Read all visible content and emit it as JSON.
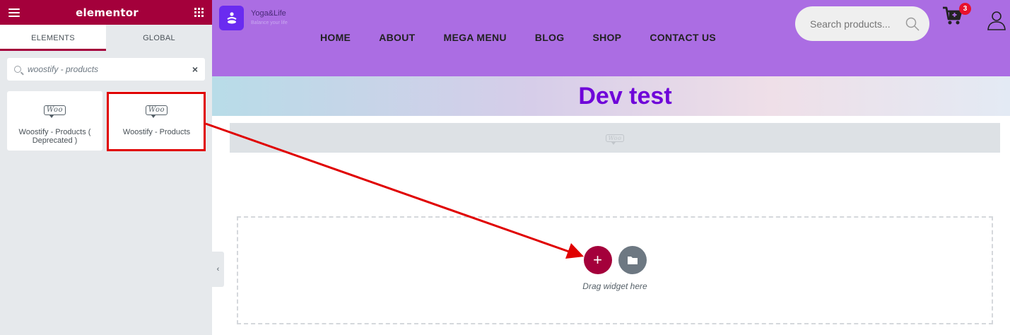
{
  "panel": {
    "brand": "elementor",
    "tabs": [
      {
        "label": "ELEMENTS",
        "active": true
      },
      {
        "label": "GLOBAL",
        "active": false
      }
    ],
    "search": {
      "value": "woostify - products",
      "clear": "×"
    },
    "widgets": [
      {
        "icon": "woo-icon",
        "icon_text": "Woo",
        "title": "Woostify - Products ( Deprecated )"
      },
      {
        "icon": "woo-icon",
        "icon_text": "Woo",
        "title": "Woostify - Products",
        "highlighted": true
      }
    ],
    "collapse_glyph": "‹",
    "accent_color": "#a4003b"
  },
  "site": {
    "logo": {
      "name": "Yoga&Life",
      "tagline": "Balance your life"
    },
    "nav": [
      "HOME",
      "ABOUT",
      "MEGA MENU",
      "BLOG",
      "SHOP",
      "CONTACT US"
    ],
    "search_placeholder": "Search products...",
    "cart_count": "3",
    "header_color": "#ab6de3",
    "page_title": "Dev test",
    "placeholder_icon_text": "Woo",
    "dropzone": {
      "add": "+",
      "hint": "Drag widget here"
    }
  },
  "annotation": {
    "color": "#e00000"
  }
}
